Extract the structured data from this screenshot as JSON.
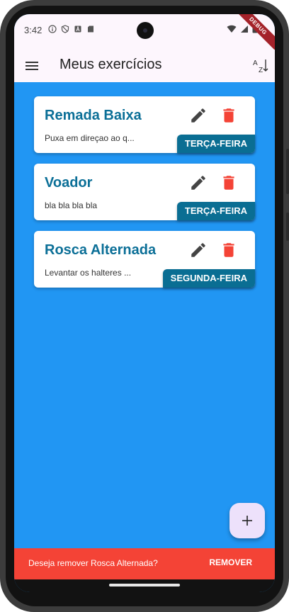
{
  "status_bar": {
    "time": "3:42",
    "left_icons": [
      "info-icon",
      "shield-icon",
      "a-badge-icon",
      "sd-card-icon"
    ],
    "right_icons": [
      "wifi-icon",
      "signal-icon",
      "battery-icon"
    ],
    "debug_banner": "DEBUG"
  },
  "app_bar": {
    "menu_icon": "menu-icon",
    "title": "Meus exercícios",
    "sort_icon": "sort-alpha-icon"
  },
  "exercises": [
    {
      "title": "Remada Baixa",
      "description": "Puxa em direçao ao q...",
      "day": "TERÇA-FEIRA"
    },
    {
      "title": "Voador",
      "description": "bla bla bla bla",
      "day": "TERÇA-FEIRA"
    },
    {
      "title": "Rosca Alternada",
      "description": "Levantar os halteres ...",
      "day": "SEGUNDA-FEIRA"
    }
  ],
  "fab": {
    "icon": "plus-icon"
  },
  "snackbar": {
    "message": "Deseja remover Rosca Alternada?",
    "action": "REMOVER"
  },
  "colors": {
    "background": "#2196F3",
    "app_bar": "#fdf6fd",
    "title_text": "#0b6f97",
    "day_tag": "#0a6e93",
    "delete": "#f44336",
    "snackbar": "#f44336",
    "fab": "#ede1fb"
  }
}
